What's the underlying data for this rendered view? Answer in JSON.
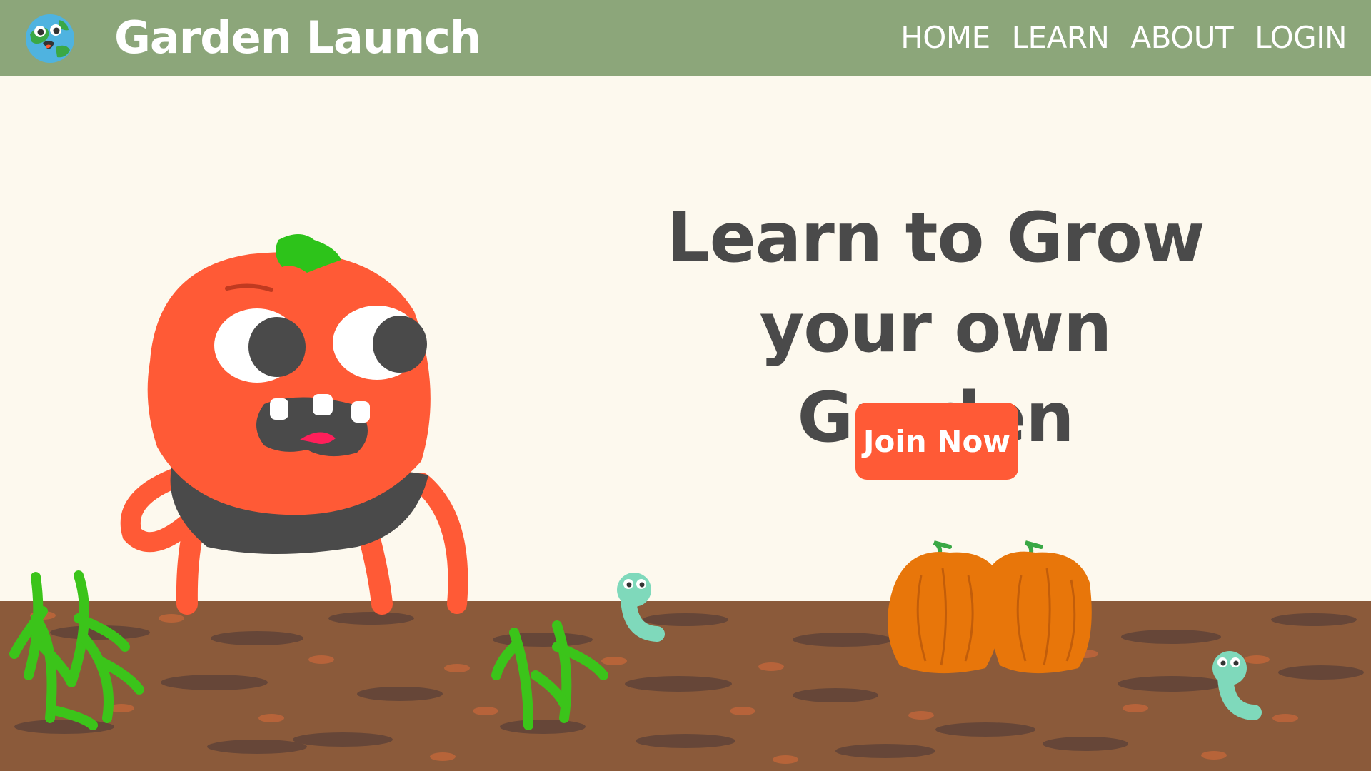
{
  "header": {
    "brand": "Garden Launch",
    "logo_icon": "earth-mascot-icon",
    "nav": [
      {
        "label": "HOME"
      },
      {
        "label": "LEARN"
      },
      {
        "label": "ABOUT"
      },
      {
        "label": "LOGIN"
      }
    ]
  },
  "hero": {
    "title_line1": "Learn to Grow",
    "title_line2": "your own Garden",
    "cta_label": "Join Now"
  },
  "colors": {
    "header_bg": "#8ca67a",
    "page_bg": "#fdf9ee",
    "title_text": "#4a4a4a",
    "cta_bg": "#ff5a36",
    "soil": "#8b5a3a",
    "tomato": "#ff5a36",
    "pumpkin": "#e8760a",
    "worm": "#7fd9bb",
    "sprout": "#3bc41a"
  },
  "illustration": {
    "characters": [
      "tomato-monster",
      "worm",
      "worm",
      "pumpkin",
      "pumpkin",
      "sprout",
      "sprout"
    ]
  }
}
